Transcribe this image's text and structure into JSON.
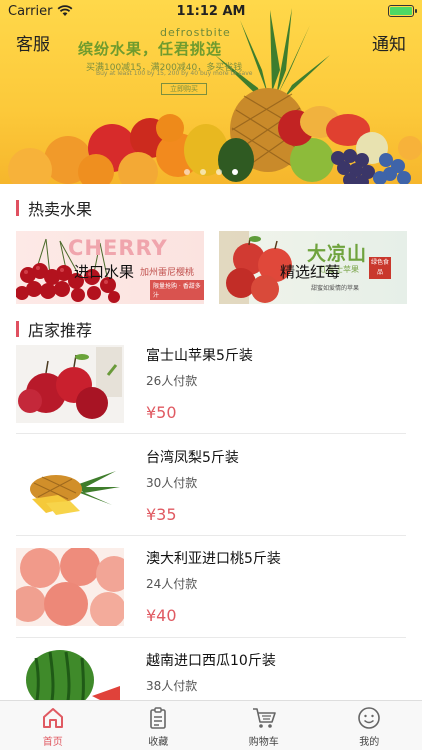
{
  "status_bar": {
    "carrier": "Carrier",
    "time": "11:12 AM",
    "battery_level": 1.0
  },
  "banner": {
    "left_link": "客服",
    "right_link": "通知",
    "brand": "defrostbite",
    "headline": "缤纷水果，任君挑选",
    "sub": "买满100减15，满200减40，多买省钱",
    "small": "Buy at least 100 by 15, 200 by 40 buy more to save",
    "button": "立即购买",
    "slides": 4,
    "active_slide": 4
  },
  "hot_section": {
    "title": "热卖水果",
    "cards": [
      {
        "label": "进口水果",
        "art_title": "CHERRY",
        "art_sub": "加州雷尼樱桃",
        "art_tag": "限量抢购 · 香甜多汁"
      },
      {
        "label": "精选红莓",
        "art_title": "大凉山",
        "art_green": "红富士苹果",
        "art_sub": "甜蜜如爱情的苹果",
        "art_seal": "绿色食品"
      }
    ]
  },
  "shop_section": {
    "title": "店家推荐",
    "products": [
      {
        "name": "富士山苹果5斤装",
        "sales": "26人付款",
        "price": "¥50"
      },
      {
        "name": "台湾凤梨5斤装",
        "sales": "30人付款",
        "price": "¥35"
      },
      {
        "name": "澳大利亚进口桃5斤装",
        "sales": "24人付款",
        "price": "¥40"
      },
      {
        "name": "越南进口西瓜10斤装",
        "sales": "38人付款",
        "price": ""
      }
    ]
  },
  "tab_bar": {
    "tabs": [
      {
        "label": "首页",
        "icon": "home-icon",
        "active": true
      },
      {
        "label": "收藏",
        "icon": "clipboard-icon",
        "active": false
      },
      {
        "label": "购物车",
        "icon": "cart-icon",
        "active": false
      },
      {
        "label": "我的",
        "icon": "smiley-icon",
        "active": false
      }
    ]
  },
  "colors": {
    "accent": "#e05a62",
    "banner_yellow": "#fcc93a",
    "section_bar": "#e05060"
  }
}
